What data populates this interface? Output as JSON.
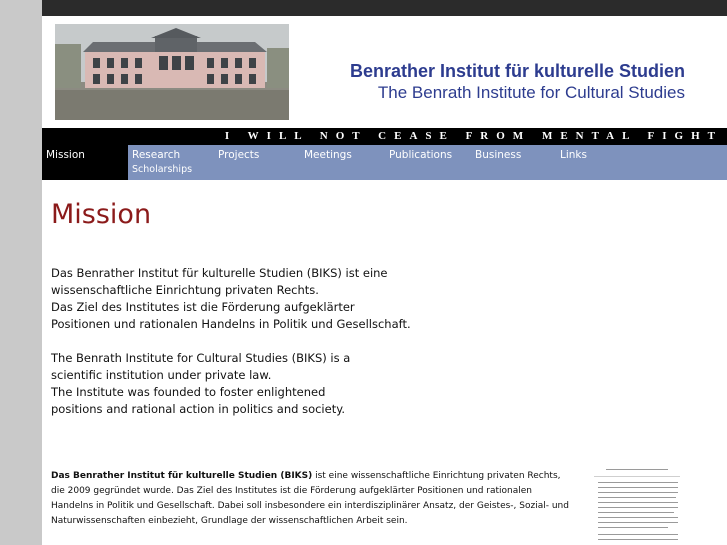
{
  "header": {
    "title_de": "Benrather Institut für kulturelle Studien",
    "title_en": "The Benrath Institute for Cultural Studies"
  },
  "motto": "I WILL NOT CEASE FROM MENTAL FIGHT",
  "nav": {
    "items": [
      {
        "label": "Mission",
        "active": true
      },
      {
        "label": "Research",
        "sub": "Scholarships"
      },
      {
        "label": "Projects"
      },
      {
        "label": "Meetings"
      },
      {
        "label": "Publications"
      },
      {
        "label": "Business"
      },
      {
        "label": "Links"
      }
    ]
  },
  "main": {
    "heading": "Mission",
    "lead_de": [
      "Das Benrather Institut für kulturelle Studien (BIKS) ist eine",
      "wissenschaftliche Einrichtung privaten Rechts.",
      "Das Ziel des Institutes ist die Förderung aufgeklärter",
      "Positionen und rationalen Handelns in Politik und Gesellschaft."
    ],
    "lead_en": [
      "The Benrath Institute for Cultural Studies (BIKS) is a",
      "scientific institution under private law.",
      "The Institute was founded to foster enlightened",
      "positions and rational action in politics and society."
    ],
    "detail_bold": "Das Benrather Institut für kulturelle Studien (BIKS)",
    "detail_rest": " ist eine wissenschaftliche Einrichtung privaten Rechts, die 2009 gegründet wurde. Das Ziel des Institutes ist die Förderung aufgeklärter Positionen und rationalen Handelns in Politik und Gesellschaft. Dabei soll insbesondere ein interdisziplinärer Ansatz, der Geistes-, Sozial- und Naturwissenschaften einbezieht, Grundlage der wissenschaftlichen Arbeit sein."
  },
  "colors": {
    "title_blue": "#2d3c8f",
    "heading_red": "#8b1a1a",
    "nav_bg": "#7e92bd",
    "motto_bg": "#000000"
  }
}
